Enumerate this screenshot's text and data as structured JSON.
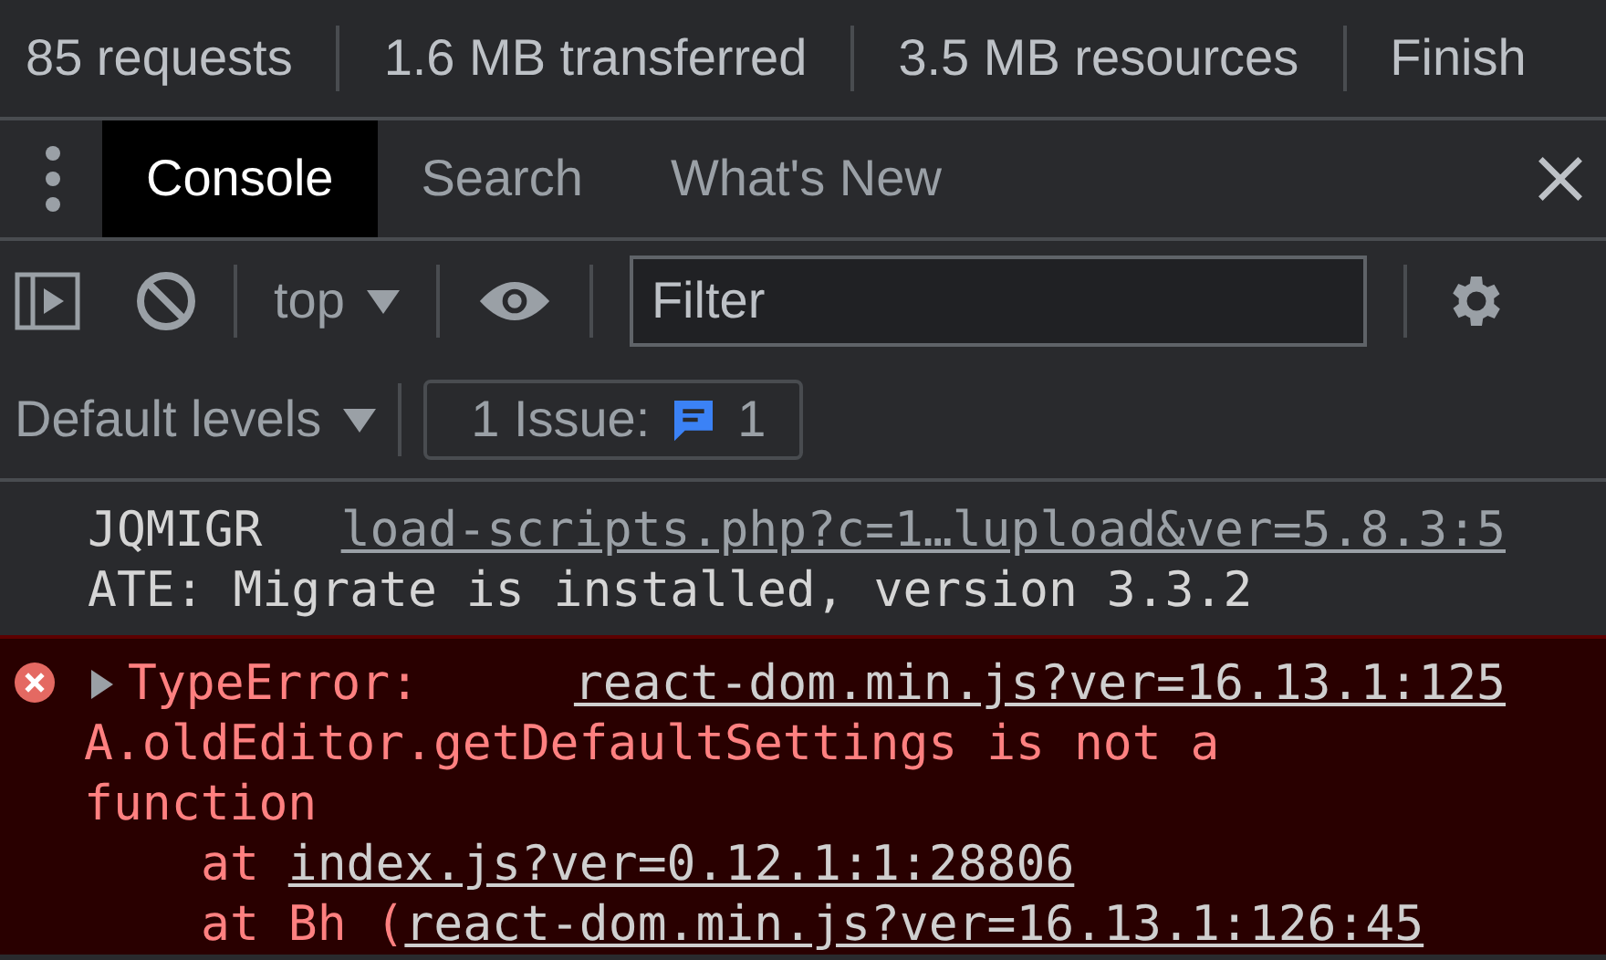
{
  "status_bar": [
    "85 requests",
    "1.6 MB transferred",
    "3.5 MB resources",
    "Finish"
  ],
  "drawer_tabs": [
    {
      "label": "Console",
      "selected": true
    },
    {
      "label": "Search",
      "selected": false
    },
    {
      "label": "What's New",
      "selected": false
    }
  ],
  "toolbar": {
    "context": "top",
    "filter": {
      "placeholder": "Filter"
    },
    "levels": "Default levels",
    "issues": {
      "label": "1 Issue:",
      "count": "1"
    }
  },
  "messages": [
    {
      "kind": "log",
      "text_start": "JQMIGR",
      "source": "load-scripts.php?c=1…lupload&ver=5.8.3:5",
      "text_rest": "ATE: Migrate is installed, version 3.3.2"
    },
    {
      "kind": "error",
      "expanded": false,
      "title": "TypeError:",
      "source": "react-dom.min.js?ver=16.13.1:125",
      "text": "A.oldEditor.getDefaultSettings is not a function",
      "stack": [
        {
          "prefix": "at ",
          "link": "index.js?ver=0.12.1:1:28806"
        },
        {
          "prefix": "at Bh (",
          "link": "react-dom.min.js?ver=16.13.1:126:45"
        }
      ]
    }
  ]
}
